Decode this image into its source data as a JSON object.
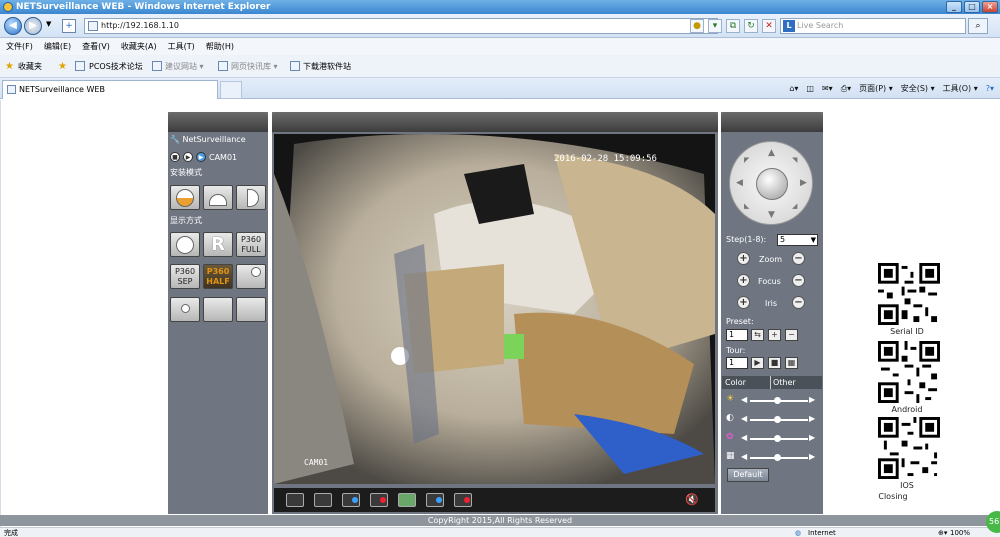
{
  "window": {
    "title": "NETSurveillance WEB - Windows Internet Explorer",
    "url": "http://192.168.1.10",
    "search_placeholder": "Live Search"
  },
  "menu": [
    "文件(F)",
    "编辑(E)",
    "查看(V)",
    "收藏夹(A)",
    "工具(T)",
    "帮助(H)"
  ],
  "favorites": {
    "label": "收藏夹",
    "items": [
      "PCOS技术论坛",
      "建议网站 ▾",
      "网页快讯库 ▾",
      "下载港软件站"
    ]
  },
  "tab": {
    "label": "NETSurveillance WEB"
  },
  "commands": [
    "页面(P) ▾",
    "安全(S) ▾",
    "工具(O) ▾"
  ],
  "left_panel": {
    "title": "NetSurveillance",
    "camera": "CAM01",
    "install_mode_label": "安装模式",
    "display_mode_label": "显示方式",
    "buttons": [
      "R",
      "P360 FULL",
      "P360 SEP",
      "P360 HALF"
    ]
  },
  "video": {
    "timestamp": "2016-02-28 15:09:56",
    "camera_label": "CAM01"
  },
  "ptz": {
    "step_label": "Step(1-8):",
    "step_value": "5",
    "zoom": "Zoom",
    "focus": "Focus",
    "iris": "Iris",
    "preset_label": "Preset:",
    "preset_value": "1",
    "tour_label": "Tour:",
    "tour_value": "1"
  },
  "color_tabs": [
    "Color",
    "Other"
  ],
  "default_label": "Default",
  "qr_labels": [
    "Serial ID",
    "Android",
    "IOS"
  ],
  "closing_label": "Closing",
  "footer": "CopyRight 2015,All Rights Reserved",
  "status": {
    "left": "完成",
    "zone": "Internet",
    "zoom": "100%"
  },
  "badge": "56"
}
